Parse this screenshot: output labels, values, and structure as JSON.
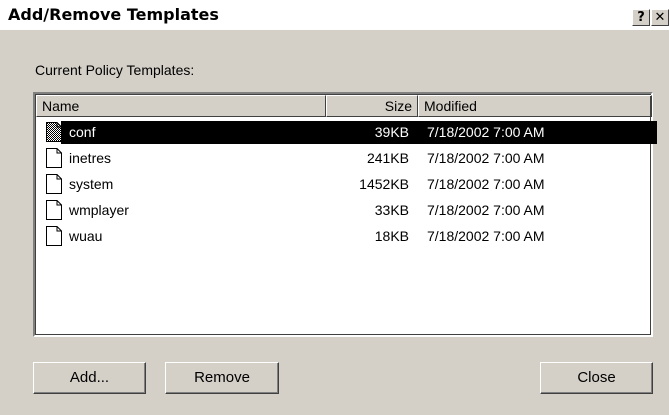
{
  "dialog": {
    "title": "Add/Remove Templates",
    "help_button": "?",
    "close_button": "✕"
  },
  "panel": {
    "label": "Current Policy Templates:"
  },
  "listview": {
    "columns": [
      "Name",
      "Size",
      "Modified"
    ],
    "rows": [
      {
        "name": "conf",
        "size": "39KB",
        "modified": "7/18/2002 7:00 AM",
        "selected": true
      },
      {
        "name": "inetres",
        "size": "241KB",
        "modified": "7/18/2002 7:00 AM",
        "selected": false
      },
      {
        "name": "system",
        "size": "1452KB",
        "modified": "7/18/2002 7:00 AM",
        "selected": false
      },
      {
        "name": "wmplayer",
        "size": "33KB",
        "modified": "7/18/2002 7:00 AM",
        "selected": false
      },
      {
        "name": "wuau",
        "size": "18KB",
        "modified": "7/18/2002 7:00 AM",
        "selected": false
      }
    ]
  },
  "buttons": {
    "add": "Add...",
    "remove": "Remove",
    "close": "Close"
  },
  "colors": {
    "face": "#d4d0c8",
    "selection": "#000000",
    "window": "#ffffff"
  },
  "icons": {
    "file": "document-icon"
  }
}
